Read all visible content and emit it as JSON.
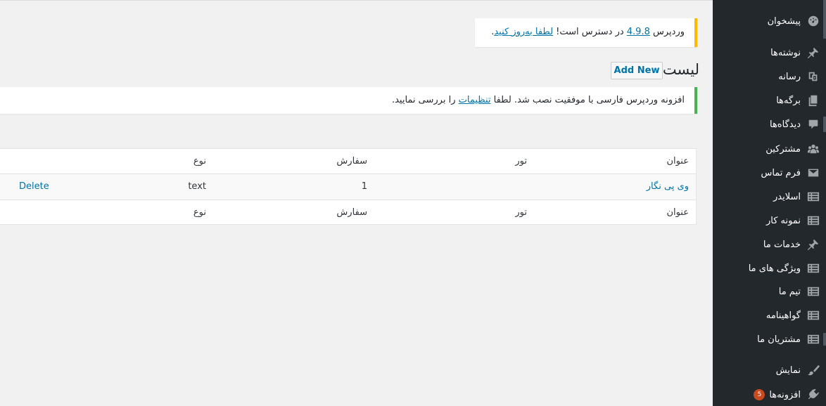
{
  "update_notice": {
    "prefix": "وردپرس ",
    "version_link": "4.9.8",
    "middle": " در دسترس است! ",
    "update_link": "لطفا به‌روز کنید",
    "suffix": "."
  },
  "page": {
    "title": "لیست",
    "add_new_label": "Add New"
  },
  "success_notice": {
    "prefix": "افزونه وردپرس فارسی با موفقیت نصب شد. لطفا ",
    "link": "تنظیمات",
    "suffix": " را بررسی نمایید."
  },
  "table": {
    "columns": [
      "عنوان",
      "تور",
      "سفارش",
      "نوع"
    ],
    "rows": [
      {
        "title": "وی پی نگار",
        "tour": "",
        "order": "1",
        "type": "text",
        "action": "Delete"
      }
    ]
  },
  "sidebar": {
    "items": [
      {
        "label": "پیشخوان",
        "icon": "dashboard-icon"
      },
      {
        "label": "نوشته‌ها",
        "icon": "pin-icon"
      },
      {
        "label": "رسانه",
        "icon": "media-icon"
      },
      {
        "label": "برگه‌ها",
        "icon": "pages-icon"
      },
      {
        "label": "دیدگاه‌ها",
        "icon": "comments-icon"
      },
      {
        "label": "مشترکین",
        "icon": "groups-icon"
      },
      {
        "label": "فرم تماس",
        "icon": "mail-icon"
      },
      {
        "label": "اسلایدر",
        "icon": "list-icon"
      },
      {
        "label": "نمونه کار",
        "icon": "list-icon"
      },
      {
        "label": "خدمات ما",
        "icon": "pin-icon"
      },
      {
        "label": "ویژگی های ما",
        "icon": "list-icon"
      },
      {
        "label": "تیم ما",
        "icon": "list-icon"
      },
      {
        "label": "گواهینامه",
        "icon": "list-icon"
      },
      {
        "label": "مشتریان ما",
        "icon": "list-icon"
      },
      {
        "label": "نمایش",
        "icon": "brush-icon"
      },
      {
        "label": "افزونه‌ها",
        "icon": "plugin-icon",
        "badge": "5"
      }
    ]
  },
  "colors": {
    "sidebar_bg": "#23282d",
    "content_bg": "#f1f1f1",
    "link": "#0073aa",
    "warning_border": "#ffb900",
    "success_border": "#46b450",
    "badge": "#ca4a1f"
  }
}
